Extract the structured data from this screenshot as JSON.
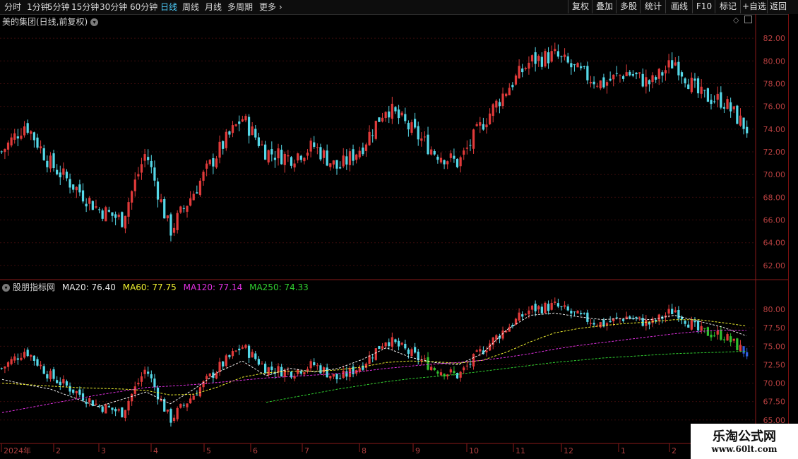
{
  "toolbar": {
    "periods": [
      "分时",
      "1分钟",
      "5分钟",
      "15分钟",
      "30分钟",
      "60分钟",
      "日线",
      "周线",
      "月线",
      "多周期",
      "更多"
    ],
    "active_period": "日线",
    "right_buttons": [
      "复权",
      "叠加",
      "多股",
      "统计",
      "画线",
      "F10",
      "标记",
      "+自选",
      "返回"
    ]
  },
  "pane1": {
    "title": "美的集团(日线,前复权)",
    "y_ticks": [
      "82.00",
      "80.00",
      "78.00",
      "76.00",
      "74.00",
      "72.00",
      "70.00",
      "68.00",
      "66.00",
      "64.00",
      "62.00"
    ]
  },
  "pane2": {
    "name": "股朋指标网",
    "ma20": "MA20: 76.40",
    "ma60": "MA60: 77.75",
    "ma120": "MA120: 77.14",
    "ma250": "MA250: 74.33",
    "y_ticks": [
      "80.00",
      "77.50",
      "75.00",
      "72.50",
      "70.00",
      "67.50",
      "65.00"
    ]
  },
  "x_axis": [
    "2024年",
    "2",
    "3",
    "4",
    "5",
    "6",
    "7",
    "8",
    "9",
    "10",
    "11",
    "12",
    "1",
    "2",
    "3"
  ],
  "watermark": {
    "title": "乐淘公式网",
    "url": "www.60lt.com"
  },
  "colors": {
    "up": "#e03a3a",
    "down": "#55d8e8",
    "ma20": "#f0f0f0",
    "ma60": "#f0f030",
    "ma120": "#e030e0",
    "ma250": "#30d030",
    "active": "#4fd0ff"
  },
  "chart_data": {
    "type": "candlestick",
    "title": "美的集团(日线,前复权)",
    "ylim": [
      61,
      83.5
    ],
    "x": [
      "2024年",
      "2",
      "3",
      "4",
      "5",
      "6",
      "7",
      "8",
      "9",
      "10",
      "11",
      "12",
      "1",
      "2",
      "3"
    ],
    "close": [
      72.0,
      74.5,
      71.0,
      69.0,
      67.0,
      66.0,
      72.0,
      65.0,
      68.5,
      72.0,
      75.0,
      72.0,
      71.5,
      72.5,
      70.5,
      72.5,
      76.0,
      74.0,
      72.0,
      71.0,
      74.5,
      77.5,
      80.0,
      80.5,
      79.0,
      78.0,
      79.0,
      78.0,
      80.0,
      77.0,
      76.5,
      74.0
    ],
    "series": [
      {
        "name": "MA20",
        "values": [
          70.5,
          69.8,
          69.2,
          68.0,
          66.8,
          67.8,
          68.8,
          67.2,
          69.2,
          71.5,
          73.0,
          71.0,
          72.0,
          71.5,
          72.0,
          73.2,
          74.8,
          73.5,
          72.8,
          72.5,
          74.0,
          77.2,
          79.2,
          79.5,
          79.0,
          78.6,
          78.8,
          78.6,
          79.2,
          78.4,
          77.6,
          76.4
        ]
      },
      {
        "name": "MA60",
        "values": [
          70.0,
          69.8,
          69.6,
          69.4,
          69.3,
          69.2,
          69.0,
          68.4,
          68.5,
          69.5,
          70.8,
          71.4,
          71.6,
          71.6,
          71.8,
          72.2,
          72.8,
          73.0,
          72.9,
          72.7,
          73.1,
          74.2,
          75.6,
          76.8,
          77.4,
          77.8,
          78.1,
          78.3,
          78.6,
          78.6,
          78.2,
          77.75
        ]
      },
      {
        "name": "MA120",
        "values": [
          66.0,
          66.6,
          67.2,
          67.8,
          68.4,
          68.9,
          69.4,
          69.6,
          69.8,
          70.1,
          70.4,
          70.7,
          70.9,
          71.1,
          71.3,
          71.6,
          72.0,
          72.3,
          72.6,
          72.8,
          73.1,
          73.5,
          74.0,
          74.6,
          75.1,
          75.5,
          75.9,
          76.3,
          76.7,
          77.0,
          77.2,
          77.14
        ]
      },
      {
        "name": "MA250",
        "values": [
          null,
          null,
          null,
          null,
          null,
          null,
          null,
          null,
          null,
          null,
          null,
          67.4,
          68.0,
          68.6,
          69.2,
          69.7,
          70.2,
          70.6,
          70.9,
          71.2,
          71.6,
          72.0,
          72.4,
          72.8,
          73.1,
          73.4,
          73.6,
          73.8,
          74.0,
          74.1,
          74.2,
          74.33
        ]
      }
    ]
  }
}
